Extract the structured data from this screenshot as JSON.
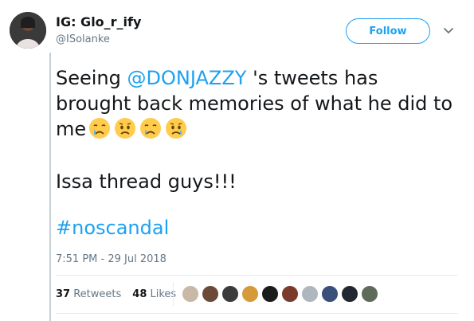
{
  "author": {
    "name": "IG: Glo_r_ify",
    "handle": "@ISolanke"
  },
  "follow_label": "Follow",
  "tweet": {
    "text_before_mention": "Seeing ",
    "mention": "@DONJAZZY",
    "text_after_mention": " 's tweets has brought back memories of what he did to me",
    "emojis": [
      "crying-face-icon",
      "worried-face-icon",
      "crying-face-icon",
      "worried-face-icon"
    ],
    "line2": "Issa thread guys!!!",
    "hashtag": "#noscandal"
  },
  "timestamp": "7:51 PM - 29 Jul 2018",
  "stats": {
    "retweets_count": "37",
    "retweets_label": "Retweets",
    "likes_count": "48",
    "likes_label": "Likes"
  },
  "liker_avatar_colors": [
    "#c9b8a6",
    "#6b4a3a",
    "#3b3b3b",
    "#d79a3a",
    "#1c1c1c",
    "#7a3b2a",
    "#b0b6bd",
    "#3a4f7a",
    "#222831",
    "#5e6b5a"
  ],
  "colors": {
    "accent": "#1da1f2",
    "text": "#14171a",
    "muted": "#657786"
  }
}
